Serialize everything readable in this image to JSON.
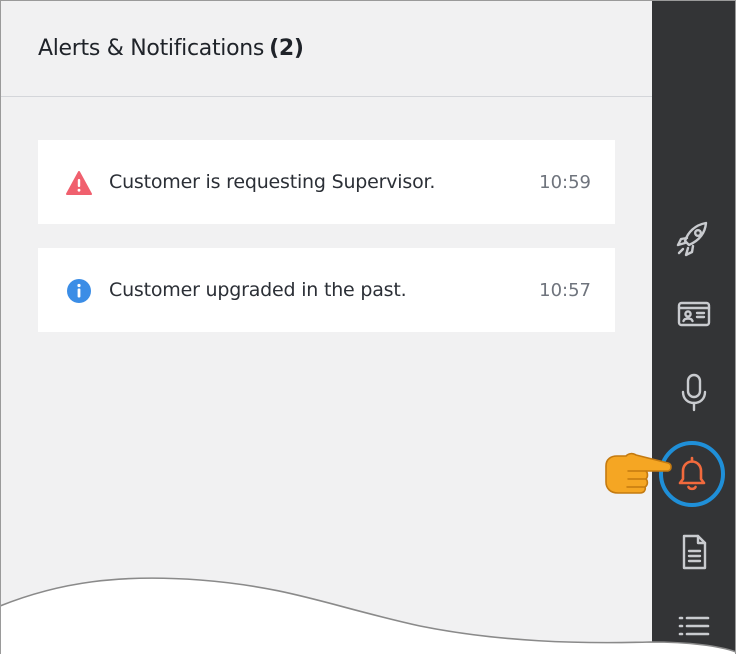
{
  "panel": {
    "title": "Alerts & Notifications",
    "count": "(2)"
  },
  "alerts": [
    {
      "type": "warning",
      "icon": "warning-triangle-icon",
      "color": "#f0606e",
      "text": "Customer is requesting Supervisor.",
      "time": "10:59"
    },
    {
      "type": "info",
      "icon": "info-circle-icon",
      "color": "#3b8de6",
      "text": "Customer upgraded in the past.",
      "time": "10:57"
    }
  ],
  "sidebar": {
    "items": [
      {
        "name": "rocket-icon",
        "active": false
      },
      {
        "name": "contact-card-icon",
        "active": false
      },
      {
        "name": "microphone-icon",
        "active": false
      },
      {
        "name": "bell-icon",
        "active": true
      },
      {
        "name": "document-icon",
        "active": false
      },
      {
        "name": "list-icon",
        "active": false
      }
    ]
  },
  "colors": {
    "rail_bg": "#333436",
    "rail_icon": "#c9cbcf",
    "active_icon": "#f26a3d",
    "highlight_ring": "#1f8fd8",
    "pointer_hand": "#f5a623",
    "panel_bg": "#f1f1f2",
    "card_bg": "#ffffff"
  }
}
